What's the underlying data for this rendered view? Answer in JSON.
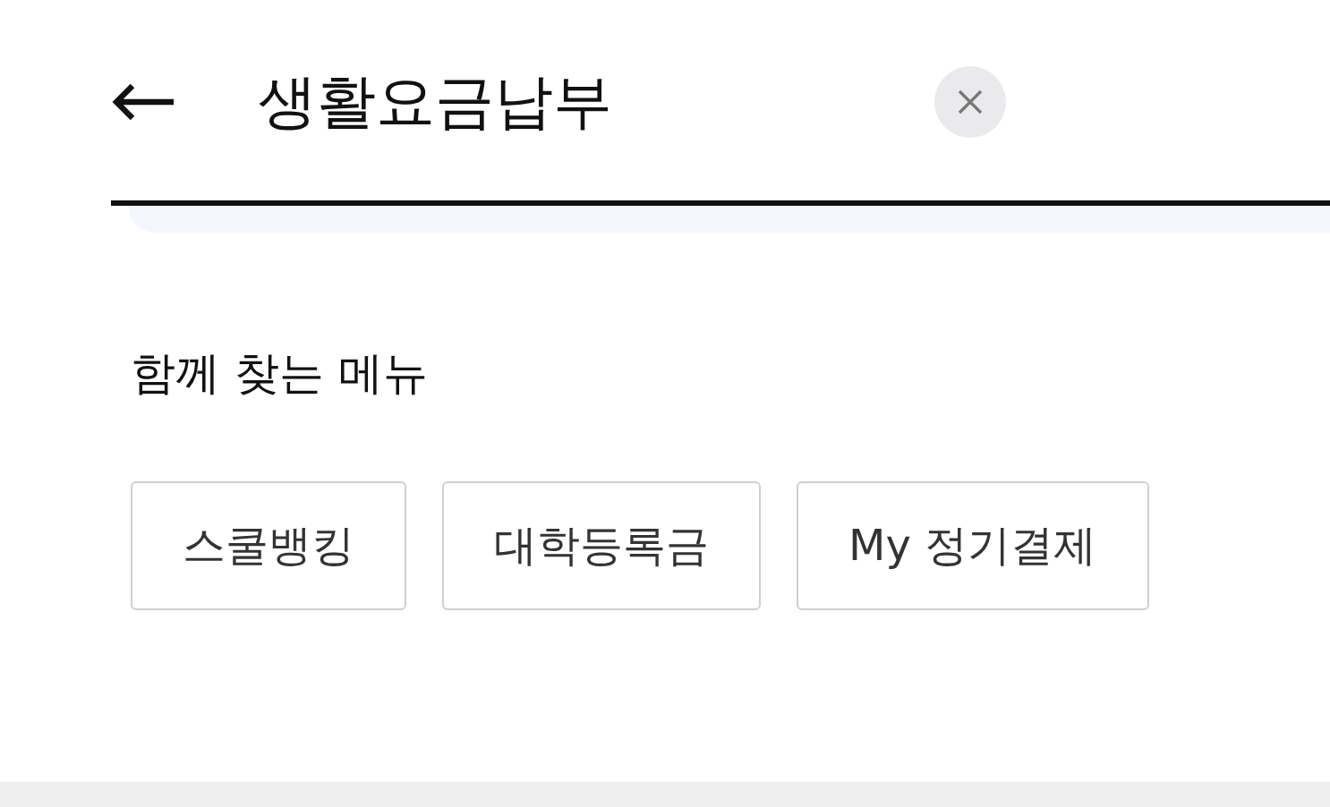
{
  "search": {
    "value": "생활요금납부"
  },
  "related": {
    "title": "함께 찾는 메뉴",
    "items": [
      "스쿨뱅킹",
      "대학등록금",
      "My 정기결제"
    ]
  }
}
